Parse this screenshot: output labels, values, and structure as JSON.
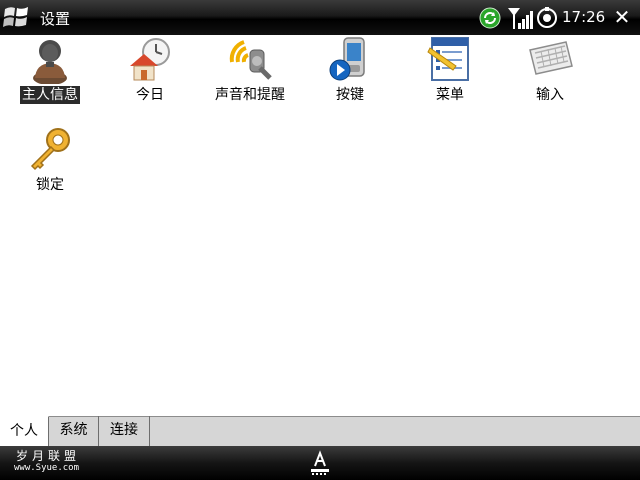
{
  "window": {
    "title": "设置",
    "clock": "17:26",
    "close_glyph": "✕",
    "icons": {
      "start": "windows-flag-icon",
      "sync": "sync-icon",
      "signal": "signal-strength-icon",
      "volume": "volume-icon"
    }
  },
  "settings_items": [
    {
      "label": "主人信息",
      "icon": "owner-info-icon",
      "selected": true
    },
    {
      "label": "今日",
      "icon": "today-clock-house-icon",
      "selected": false
    },
    {
      "label": "声音和提醒",
      "icon": "sound-notification-icon",
      "selected": false
    },
    {
      "label": "按键",
      "icon": "buttons-phone-icon",
      "selected": false
    },
    {
      "label": "菜单",
      "icon": "menus-icon",
      "selected": false
    },
    {
      "label": "输入",
      "icon": "keyboard-input-icon",
      "selected": false
    },
    {
      "label": "锁定",
      "icon": "lock-key-icon",
      "selected": false
    }
  ],
  "tabs": [
    {
      "label": "个人",
      "active": true
    },
    {
      "label": "系统",
      "active": false
    },
    {
      "label": "连接",
      "active": false
    }
  ],
  "softbar": {
    "watermark_title": "岁月联盟",
    "watermark_url": "www.Syue.com",
    "sip_icon": "input-panel-keyboard-icon"
  },
  "colors": {
    "titlebar": "#000000",
    "selection": "#2b2b2b",
    "tabstrip": "#d6d6d6",
    "sync_green": "#2aa52a"
  }
}
